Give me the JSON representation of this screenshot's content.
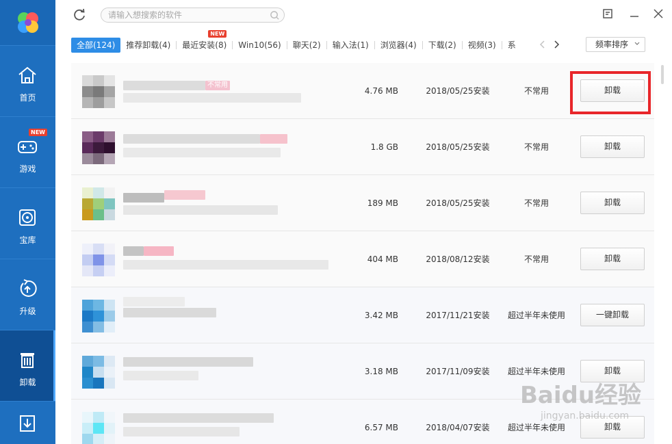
{
  "sidebar": {
    "items": [
      {
        "label": "首页",
        "icon": "home-icon"
      },
      {
        "label": "游戏",
        "icon": "gamepad-icon",
        "badge": "NEW"
      },
      {
        "label": "宝库",
        "icon": "disc-icon"
      },
      {
        "label": "升级",
        "icon": "upgrade-icon"
      },
      {
        "label": "卸载",
        "icon": "trash-icon",
        "active": true
      },
      {
        "label": "",
        "icon": "download-icon"
      }
    ]
  },
  "header": {
    "search_placeholder": "请输入想搜索的软件"
  },
  "tabs": [
    {
      "label": "全部(124)",
      "active": true
    },
    {
      "label": "推荐卸载(4)"
    },
    {
      "label": "最近安装(8)",
      "badge": "NEW"
    },
    {
      "label": "Win10(56)"
    },
    {
      "label": "聊天(2)"
    },
    {
      "label": "输入法(1)"
    },
    {
      "label": "浏览器(4)"
    },
    {
      "label": "下载(2)"
    },
    {
      "label": "视频(3)"
    },
    {
      "label": "系"
    }
  ],
  "sort_label": "频率排序",
  "rows": [
    {
      "size": "4.76 MB",
      "date": "2018/05/25安装",
      "usage": "不常用",
      "action": "卸载"
    },
    {
      "size": "1.8 GB",
      "date": "2018/05/25安装",
      "usage": "不常用",
      "action": "卸载"
    },
    {
      "size": "189 MB",
      "date": "2018/05/25安装",
      "usage": "不常用",
      "action": "卸载"
    },
    {
      "size": "404 MB",
      "date": "2018/08/12安装",
      "usage": "不常用",
      "action": "卸载"
    },
    {
      "size": "3.42 MB",
      "date": "2017/11/21安装",
      "usage": "超过半年未使用",
      "action": "一键卸载"
    },
    {
      "size": "3.18 MB",
      "date": "2017/11/09安装",
      "usage": "超过半年未使用",
      "action": "卸载"
    },
    {
      "size": "6.57 MB",
      "date": "2018/04/07安装",
      "usage": "超过半年未使用",
      "action": "卸载"
    }
  ],
  "row1_blur_tag": "不常用",
  "watermark": {
    "main": "Baidu经验",
    "sub": "jingyan.baidu.com"
  },
  "colors": {
    "sidebar": "#1e6fbf",
    "sidebar_active": "#0f4f94",
    "tab_active": "#2e8de6",
    "highlight": "#e8262a",
    "badge": "#e8402f"
  }
}
